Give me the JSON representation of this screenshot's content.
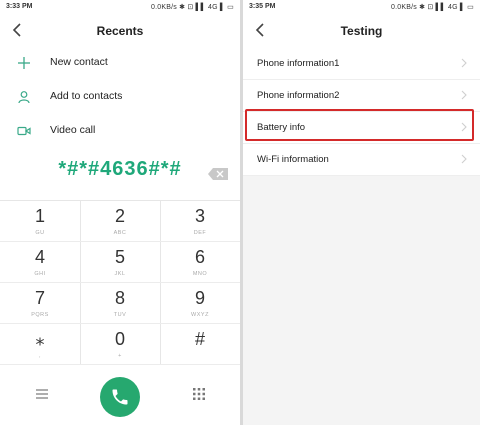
{
  "left_screen": {
    "status": {
      "time": "3:33 PM",
      "info": "0.0KB/s ✱ ⊡ ▌▌ 4G ▌ ▭"
    },
    "title": "Recents",
    "actions": [
      {
        "label": "New contact",
        "icon": "plus-icon"
      },
      {
        "label": "Add to contacts",
        "icon": "person-icon"
      },
      {
        "label": "Video call",
        "icon": "video-icon"
      }
    ],
    "dialed_number": "*#*#4636#*#",
    "keypad": [
      {
        "digit": "1",
        "letters": "GU"
      },
      {
        "digit": "2",
        "letters": "ABC"
      },
      {
        "digit": "3",
        "letters": "DEF"
      },
      {
        "digit": "4",
        "letters": "GHI"
      },
      {
        "digit": "5",
        "letters": "JKL"
      },
      {
        "digit": "6",
        "letters": "MNO"
      },
      {
        "digit": "7",
        "letters": "PQRS"
      },
      {
        "digit": "8",
        "letters": "TUV"
      },
      {
        "digit": "9",
        "letters": "WXYZ"
      },
      {
        "digit": "⁎",
        "letters": ","
      },
      {
        "digit": "0",
        "letters": "+"
      },
      {
        "digit": "#",
        "letters": ""
      }
    ],
    "accent_color": "#26a86f"
  },
  "right_screen": {
    "status": {
      "time": "3:35 PM",
      "info": "0.0KB/s ✱ ⊡ ▌▌ 4G ▌ ▭"
    },
    "title": "Testing",
    "items": [
      {
        "label": "Phone information1"
      },
      {
        "label": "Phone information2"
      },
      {
        "label": "Battery info",
        "highlighted": true
      },
      {
        "label": "Wi-Fi information"
      }
    ],
    "highlight_color": "#d42a2a"
  }
}
